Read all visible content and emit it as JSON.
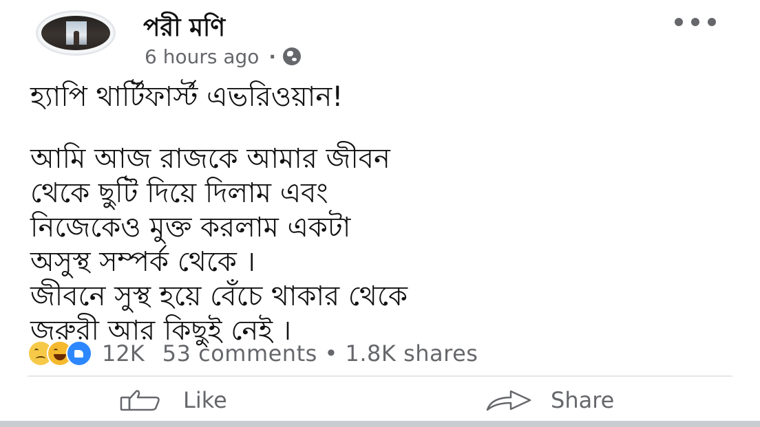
{
  "post": {
    "author": "পরী মণি",
    "timestamp": "6 hours ago",
    "separator": "·",
    "privacy_icon": "globe-icon",
    "more_icon": "more-dots-icon",
    "body_lines": [
      "হ্যাপি থার্টিফার্স্ট এভরিওয়ান!",
      "আমি আজ রাজকে আমার জীবন",
      "থেকে ছুটি দিয়ে দিলাম এবং",
      "নিজেকেও মুক্ত করলাম একটা",
      "অসুস্থ সম্পর্ক থেকে ।",
      "জীবনে সুস্থ হয়ে বেঁচে থাকার থেকে",
      "জরুরী আর কিছুই নেই ।"
    ]
  },
  "reactions": {
    "icons": [
      "sad-emoji-icon",
      "haha-emoji-icon",
      "like-reaction-icon"
    ],
    "count": "12K",
    "comments": "53 comments",
    "bullet": "•",
    "shares": "1.8K shares"
  },
  "actions": {
    "like_label": "Like",
    "share_label": "Share"
  },
  "colors": {
    "secondary_text": "#65676b",
    "like_blue": "#2d88ff",
    "divider": "#e4e6eb"
  }
}
